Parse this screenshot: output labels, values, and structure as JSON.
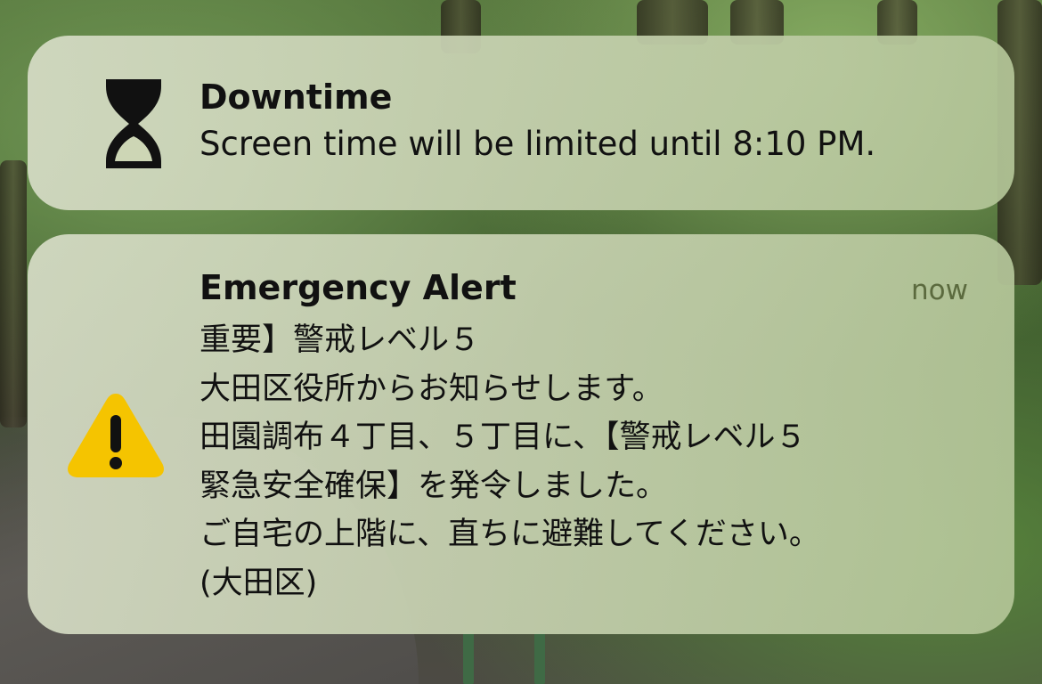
{
  "notifications": {
    "downtime": {
      "icon": "hourglass-icon",
      "title": "Downtime",
      "message": "Screen time will be limited until 8:10 PM."
    },
    "emergency": {
      "icon": "warning-triangle-icon",
      "title": "Emergency Alert",
      "time": "now",
      "lines": [
        "重要】警戒レベル５",
        "大田区役所からお知らせします。",
        "田園調布４丁目、５丁目に、【警戒レベル５",
        "緊急安全確保】を発令しました。",
        "ご自宅の上階に、直ちに避難してください。",
        "(大田区)"
      ],
      "warning_color": "#F5C400"
    }
  }
}
